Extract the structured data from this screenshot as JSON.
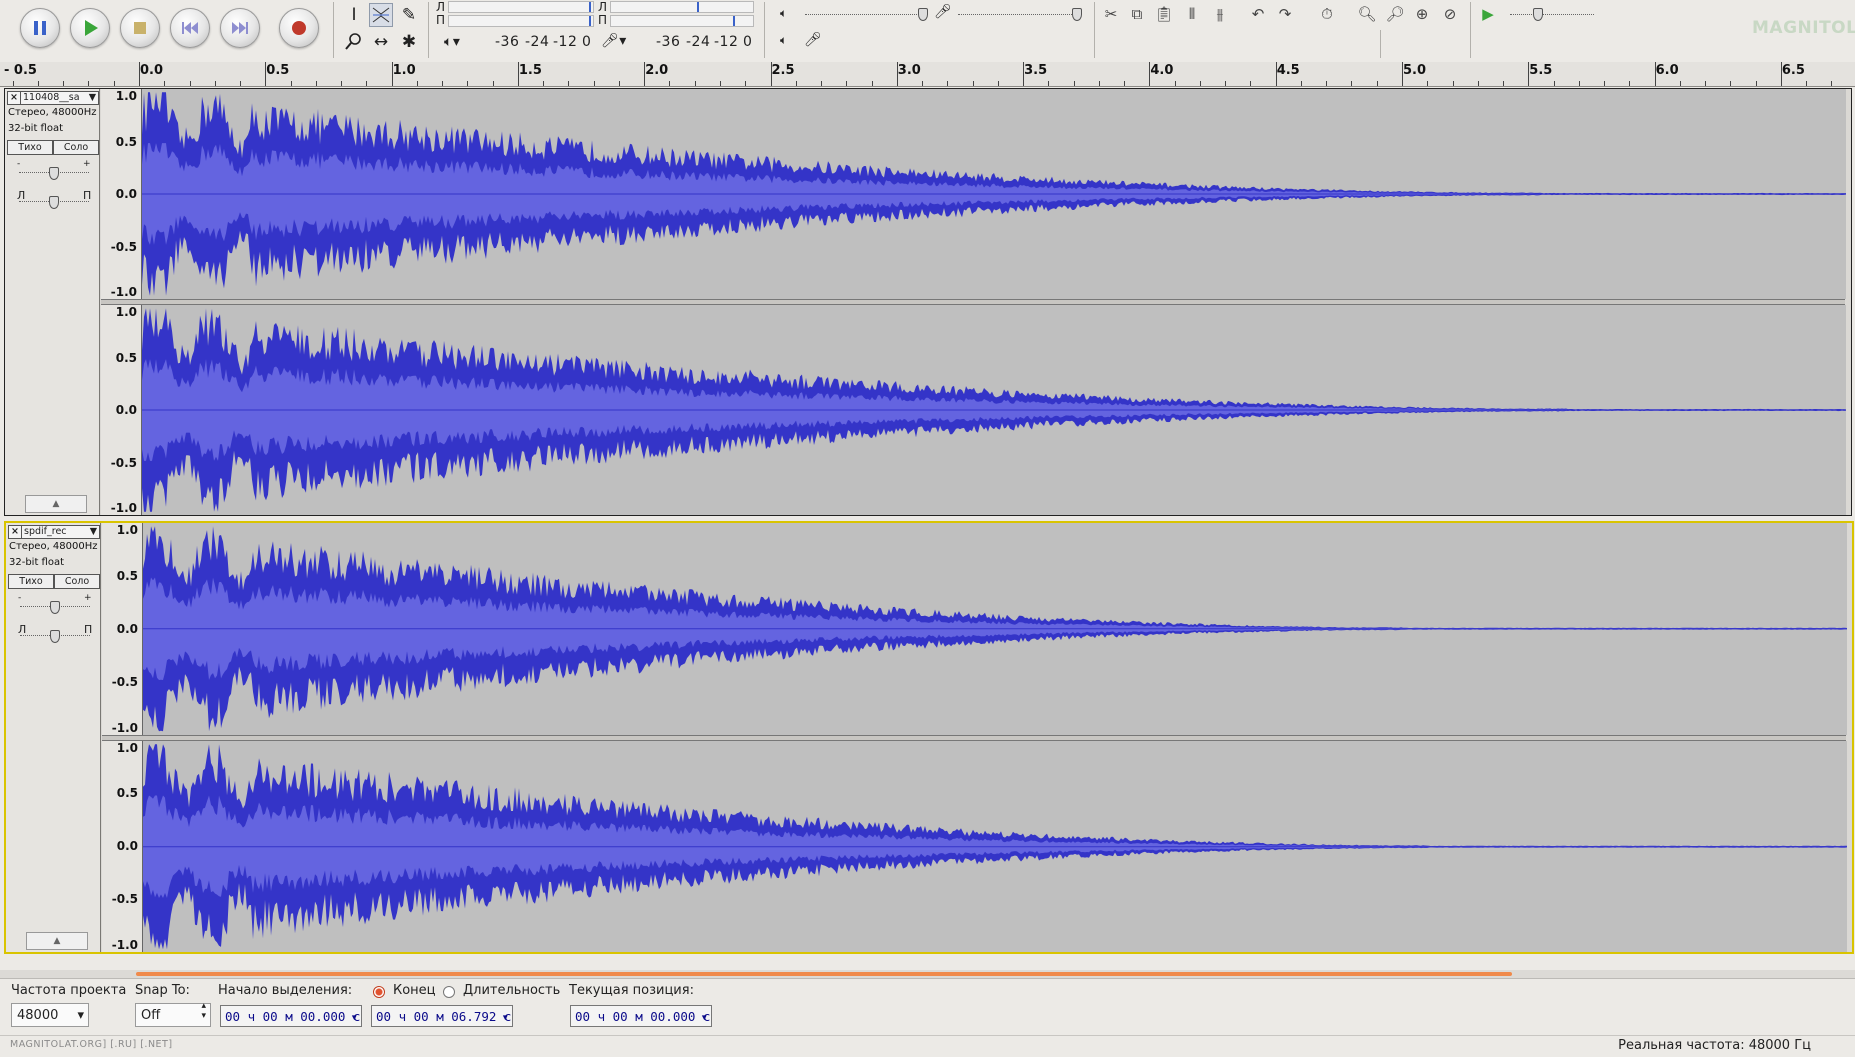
{
  "colors": {
    "wave_outer": "#3434c8",
    "wave_inner": "#6464e0",
    "wave_bg": "#bfbfbf",
    "selection_border": "#d9c400",
    "scroll_thumb": "#f08a4b",
    "play_green": "#3aa63a",
    "record_red": "#c0392b"
  },
  "transport": {
    "pause": "pause-icon",
    "play": "play-icon",
    "stop": "stop-icon",
    "skip_start": "skip-to-start-icon",
    "skip_end": "skip-to-end-icon",
    "record": "record-icon"
  },
  "tools": [
    "selection-tool-icon",
    "envelope-tool-icon",
    "draw-tool-icon",
    "zoom-tool-icon",
    "timeshift-tool-icon",
    "multi-tool-icon"
  ],
  "meters": {
    "play_left": "Л",
    "play_right": "П",
    "rec_left": "Л",
    "rec_right": "П",
    "play_scale": [
      "-36",
      "-24",
      "-12",
      "0"
    ],
    "rec_scale": [
      "-36",
      "-24",
      "-12",
      "0"
    ]
  },
  "ruler": {
    "start_label": "- 0.5",
    "labels": [
      "0.0",
      "0.5",
      "1.0",
      "1.5",
      "2.0",
      "2.5",
      "3.0",
      "3.5",
      "4.0",
      "4.5",
      "5.0",
      "5.5",
      "6.0",
      "6.5"
    ]
  },
  "amplitude_labels": [
    "1.0",
    "0.5",
    "0.0",
    "-0.5",
    "-1.0"
  ],
  "tracks": [
    {
      "name": "110408__sa",
      "format": "Стерео, 48000Hz",
      "bits": "32-bit float",
      "mute": "Тихо",
      "solo": "Соло",
      "gain_minus": "-",
      "gain_plus": "+",
      "pan_left": "Л",
      "pan_right": "П",
      "decay_end_s": [
        5.55,
        5.65
      ]
    },
    {
      "name": "spdif_rec",
      "format": "Стерео, 48000Hz",
      "bits": "32-bit float",
      "mute": "Тихо",
      "solo": "Соло",
      "gain_minus": "-",
      "gain_plus": "+",
      "pan_left": "Л",
      "pan_right": "П",
      "decay_end_s": [
        5.0,
        5.1
      ]
    }
  ],
  "selection_bar": {
    "project_rate_label": "Частота проекта",
    "project_rate_value": "48000",
    "snap_label": "Snap To:",
    "snap_value": "Off",
    "sel_start_label": "Начало выделения:",
    "end_label": "Конец",
    "length_label": "Длительность",
    "position_label": "Текущая позиция:",
    "sel_start": "00 ч 00 м 00.000 с",
    "sel_end": "00 ч 00 м 06.792 с",
    "position": "00 ч 00 м 00.000 с"
  },
  "status": {
    "left": "MAGNITOLAT.ORG] [.RU] [.NET]",
    "right": "Реальная частота: 48000 Гц"
  },
  "logo_text": "MAGNITOLA"
}
